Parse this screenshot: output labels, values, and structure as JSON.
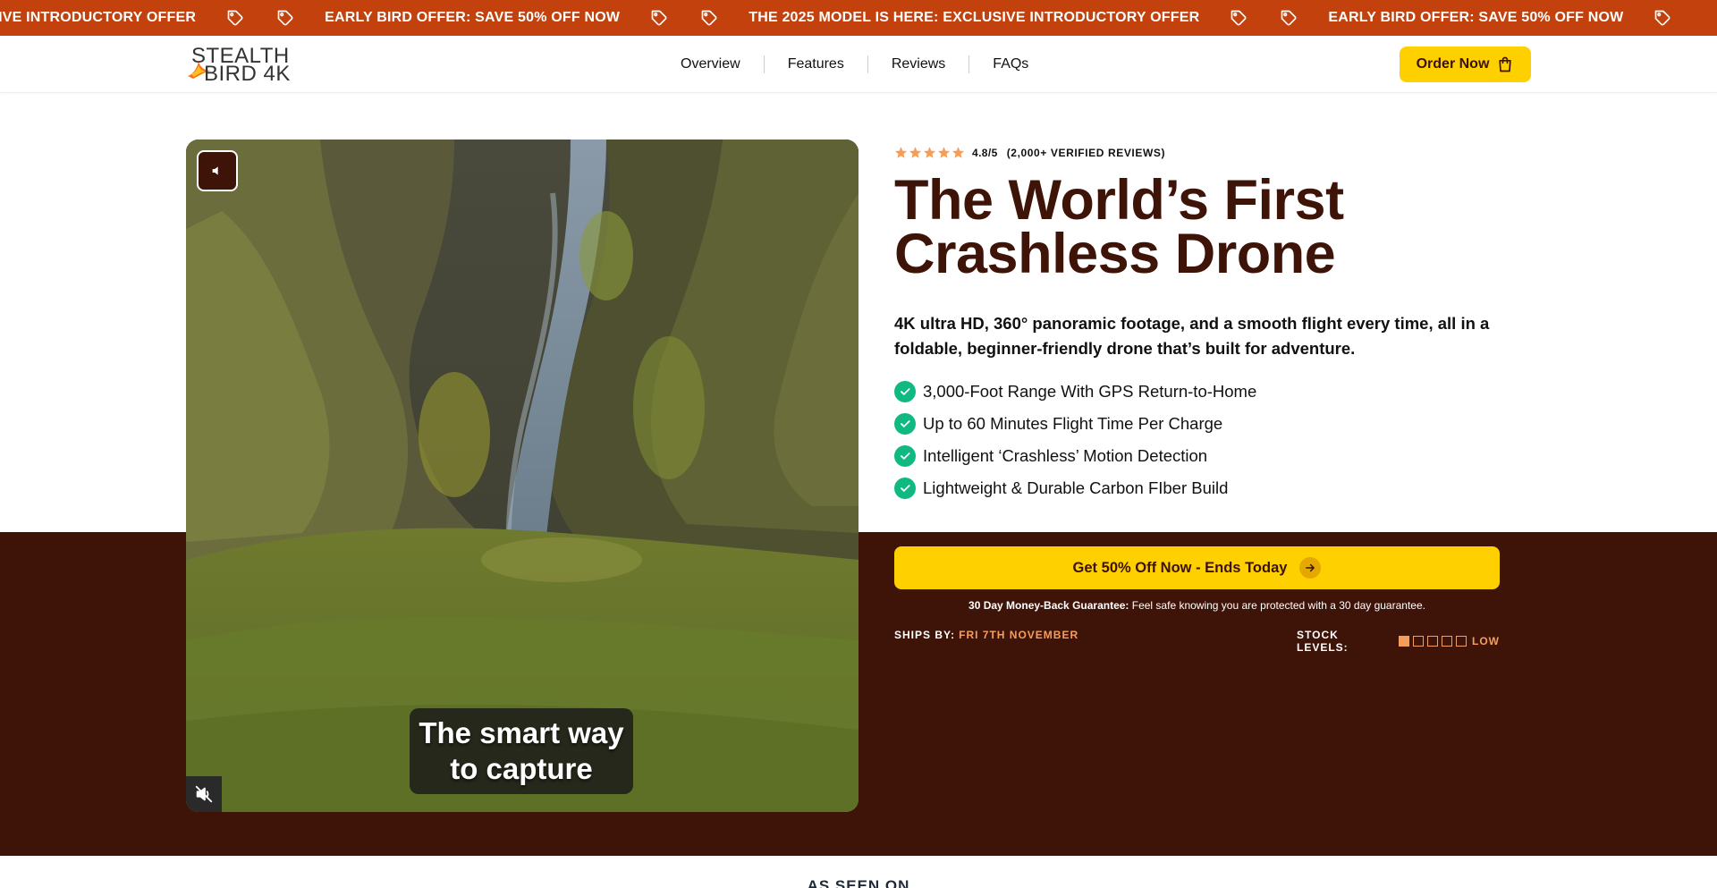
{
  "ticker": {
    "items": [
      "EXCLUSIVE INTRODUCTORY OFFER",
      "EARLY BIRD OFFER: SAVE 50% OFF NOW",
      "THE 2025 MODEL IS HERE: EXCLUSIVE INTRODUCTORY OFFER",
      "EARLY BIRD OFFER: SAVE 50% OFF NOW"
    ],
    "first_item_visible": "USIVE INTRODUCTORY OFFER",
    "background": "#c2410c",
    "icon": "tag-icon"
  },
  "header": {
    "logo": {
      "line1": "STEALTH",
      "line2": "BIRD 4K"
    },
    "nav": [
      "Overview",
      "Features",
      "Reviews",
      "FAQs"
    ],
    "order_button": {
      "label": "Order Now",
      "icon": "shopping-bag-icon",
      "color": "#ffd000"
    }
  },
  "hero": {
    "video": {
      "caption_line1": "The smart way",
      "caption_line2": "to capture",
      "sound_icon": "speaker-icon",
      "mute_icon": "muted-speaker-icon"
    },
    "rating": {
      "stars": 5,
      "score": "4.8/5",
      "count": "(2,000+ VERIFIED REVIEWS)",
      "star_color": "#f59e5b"
    },
    "headline_line1": "The World’s First",
    "headline_line2": "Crashless Drone",
    "headline_color": "#3f1408",
    "subhead": "4K ultra HD, 360° panoramic footage, and a smooth flight every time, all in a foldable, beginner-friendly drone that’s built for adventure.",
    "features": [
      "3,000-Foot Range With GPS Return-to-Home",
      "Up to 60 Minutes Flight Time Per Charge",
      "Intelligent ‘Crashless’ Motion Detection",
      "Lightweight & Durable Carbon FIber Build"
    ],
    "check_color": "#10b981",
    "cta": {
      "label": "Get 50% Off Now - Ends Today",
      "icon": "arrow-right-icon",
      "color": "#ffd000"
    },
    "guarantee": {
      "bold": "30 Day Money-Back Guarantee:",
      "text": " Feel safe knowing you are protected with a 30 day guarantee."
    },
    "ships": {
      "label": "SHIPS BY:",
      "date": "FRI 7TH NOVEMBER"
    },
    "stock": {
      "label": "STOCK LEVELS:",
      "level_filled": 1,
      "level_total": 5,
      "status": "LOW"
    }
  },
  "band_color": "#3f1408",
  "seen_on": "AS SEEN ON"
}
